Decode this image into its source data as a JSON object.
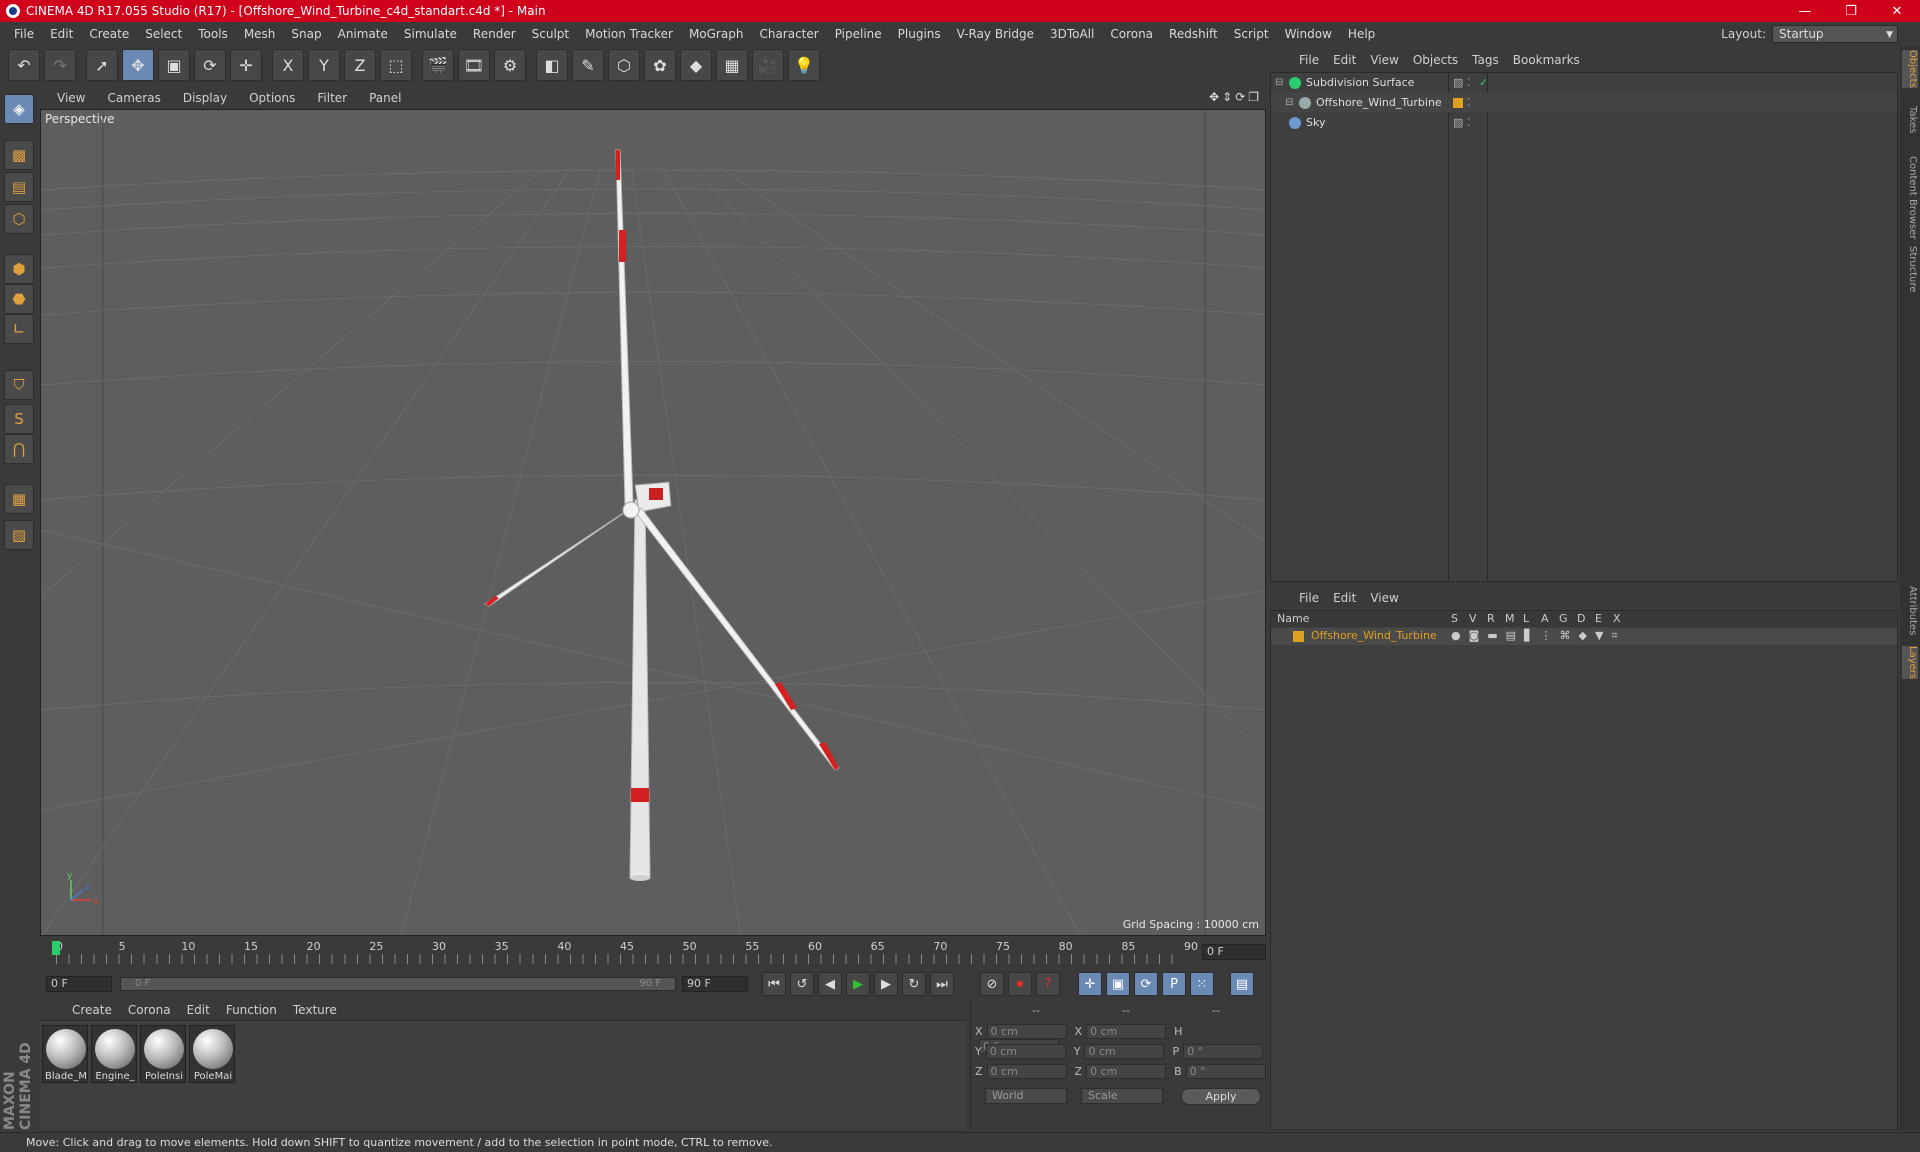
{
  "window": {
    "title": "CINEMA 4D R17.055 Studio (R17) - [Offshore_Wind_Turbine_c4d_standart.c4d *] - Main",
    "minimize": "—",
    "maximize": "❐",
    "close": "✕"
  },
  "menubar": [
    "File",
    "Edit",
    "Create",
    "Select",
    "Tools",
    "Mesh",
    "Snap",
    "Animate",
    "Simulate",
    "Render",
    "Sculpt",
    "Motion Tracker",
    "MoGraph",
    "Character",
    "Pipeline",
    "Plugins",
    "V-Ray Bridge",
    "3DToAll",
    "Corona",
    "Redshift",
    "Script",
    "Window",
    "Help"
  ],
  "layout": {
    "label": "Layout:",
    "value": "Startup"
  },
  "toolbar": {
    "icons": [
      "undo-icon",
      "redo-icon",
      "select-arrow-icon",
      "move-icon",
      "scale-icon",
      "rotate-icon",
      "live-select-icon",
      "x-axis-icon",
      "y-axis-icon",
      "z-axis-icon",
      "coordinate-system-icon",
      "render-view-icon",
      "render-picture-viewer-icon",
      "edit-render-settings-icon",
      "cube-icon",
      "pen-icon",
      "subdivision-icon",
      "cloner-icon",
      "deformer-icon",
      "floor-icon",
      "camera-icon",
      "light-icon"
    ],
    "glyphs": [
      "↶",
      "↷",
      "➚",
      "✥",
      "▣",
      "⟳",
      "✛",
      "X",
      "Y",
      "Z",
      "⬚",
      "🎬",
      "🎞",
      "⚙",
      "◧",
      "✎",
      "⬡",
      "✿",
      "◆",
      "▦",
      "🎥",
      "💡"
    ]
  },
  "leftbar": {
    "icons": [
      "model-mode-icon",
      "texture-mode-icon",
      "workplane-icon",
      "points-mode-icon",
      "edges-mode-icon",
      "polygons-mode-icon",
      "axis-mode-icon",
      "tweak-mode-icon",
      "solo-mode-icon",
      "snap-magnet-icon",
      "locked-workplane-icon",
      "planar-workplane-icon"
    ],
    "glyphs": [
      "◈",
      "▩",
      "▤",
      "⬡",
      "⬢",
      "⬣",
      "∟",
      "⛉",
      "S",
      "⋂",
      "▦",
      "▧"
    ]
  },
  "viewport": {
    "menu": [
      "View",
      "Cameras",
      "Display",
      "Options",
      "Filter",
      "Panel"
    ],
    "nav": "✥⇕⟳❐",
    "label": "Perspective",
    "grid_spacing": "Grid Spacing : 10000 cm",
    "axis_y": "y",
    "axis_z": "z",
    "axis_x": "x"
  },
  "timeline": {
    "ticks": [
      "0",
      "5",
      "10",
      "15",
      "20",
      "25",
      "30",
      "35",
      "40",
      "45",
      "50",
      "55",
      "60",
      "65",
      "70",
      "75",
      "80",
      "85",
      "90"
    ],
    "current_frame": "0 F",
    "start_field": "0 F",
    "scrub_start": "0 F",
    "scrub_end": "90 F",
    "end_field": "90 F"
  },
  "playback": {
    "buttons": [
      "go-to-start",
      "previous-key",
      "previous-frame",
      "play",
      "next-frame",
      "next-key",
      "go-to-end"
    ],
    "glyphs": [
      "⏮",
      "↺",
      "◀",
      "▶",
      "▶",
      "↻",
      "⏭"
    ],
    "key_buttons": [
      "⊘",
      "⏺",
      "?"
    ],
    "mode_buttons": [
      "✛",
      "▣",
      "⟳",
      "P",
      "⁙"
    ],
    "timeline_btn": "▤"
  },
  "material_menu": [
    "Create",
    "Corona",
    "Edit",
    "Function",
    "Texture"
  ],
  "materials": [
    {
      "name": "Blade_M"
    },
    {
      "name": "Engine_"
    },
    {
      "name": "PoleInsi"
    },
    {
      "name": "PoleMai"
    }
  ],
  "coords": {
    "header": [
      "--",
      "--",
      "--"
    ],
    "rows": [
      {
        "a": "X",
        "av": "0 cm",
        "b": "X",
        "bv": "0 cm",
        "c": "H",
        "cv": "0 °"
      },
      {
        "a": "Y",
        "av": "0 cm",
        "b": "Y",
        "bv": "0 cm",
        "c": "P",
        "cv": "0 °"
      },
      {
        "a": "Z",
        "av": "0 cm",
        "b": "Z",
        "bv": "0 cm",
        "c": "B",
        "cv": "0 °"
      }
    ],
    "world": "World",
    "scale": "Scale",
    "apply": "Apply"
  },
  "objects_menu": [
    "File",
    "Edit",
    "View",
    "Objects",
    "Tags",
    "Bookmarks"
  ],
  "objects": [
    {
      "name": "Subdivision Surface",
      "color": "#2ecc71"
    },
    {
      "name": "Offshore_Wind_Turbine",
      "color": "#9aa"
    },
    {
      "name": "Sky",
      "color": "#6b9bd1"
    }
  ],
  "layers_menu": [
    "File",
    "Edit",
    "View"
  ],
  "layers": {
    "columns": [
      "Name",
      "S",
      "V",
      "R",
      "M",
      "L",
      "A",
      "G",
      "D",
      "E",
      "X"
    ],
    "row": "Offshore_Wind_Turbine",
    "accent": "#e0a020"
  },
  "right_tabs": [
    "Objects",
    "Takes",
    "Content Browser",
    "Structure",
    "Attributes",
    "Layers"
  ],
  "status": "Move: Click and drag to move elements. Hold down SHIFT to quantize movement / add to the selection in point mode, CTRL to remove.",
  "brand": "MAXON CINEMA 4D",
  "title_bar_color": "#d0021b"
}
